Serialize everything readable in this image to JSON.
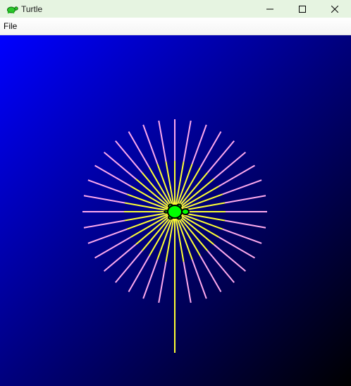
{
  "window": {
    "title": "Turtle",
    "icon": "turtle-icon",
    "controls": [
      "minimize-icon",
      "maximize-icon",
      "close-icon"
    ]
  },
  "menu": {
    "items": [
      {
        "label": "File"
      }
    ]
  },
  "canvas": {
    "background_gradient": [
      "#0000ff",
      "#00007d",
      "#000000"
    ],
    "ray_colors": {
      "inner": "#ffff33",
      "outer": "#ffaaee"
    },
    "ray_count": 36,
    "ray_angle_step_degrees": 10,
    "turtle_color": "#00ff00",
    "turtle_outline": "#000000",
    "pen_stem_color": "#ffff33"
  }
}
